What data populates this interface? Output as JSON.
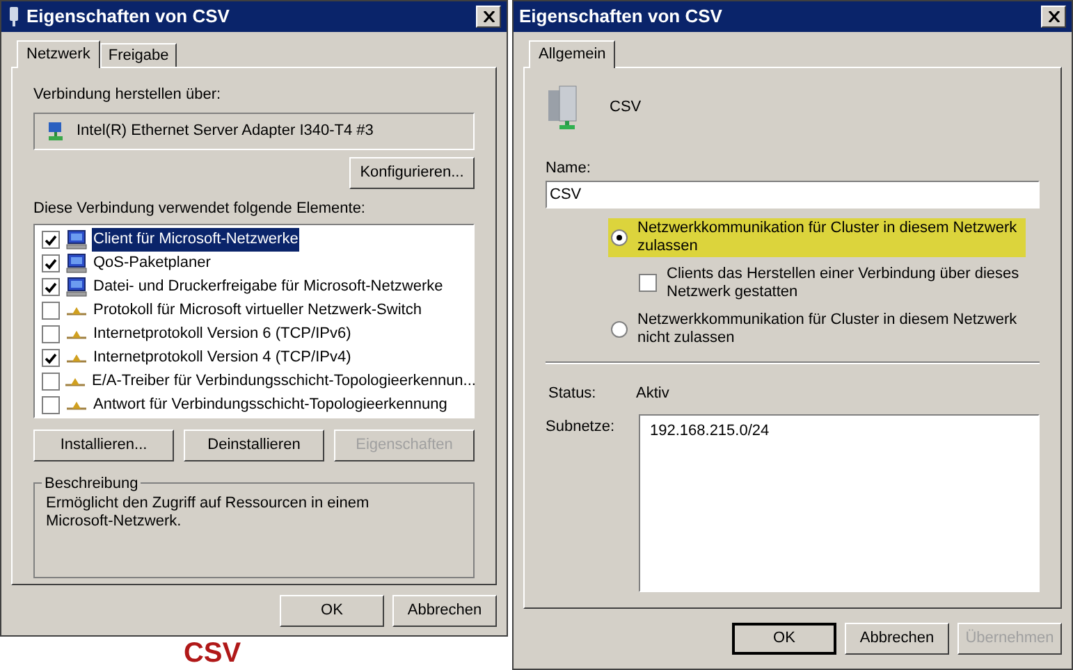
{
  "left_window": {
    "title": "Eigenschaften von CSV",
    "tabs": [
      {
        "label": "Netzwerk",
        "selected": true
      },
      {
        "label": "Freigabe",
        "selected": false
      }
    ],
    "connect_label": "Verbindung herstellen über:",
    "adapter": "Intel(R) Ethernet Server Adapter I340-T4 #3",
    "configure_button": "Konfigurieren...",
    "elements_label": "Diese Verbindung verwendet folgende Elemente:",
    "elements": [
      {
        "kind": "service",
        "label": "Client für Microsoft-Netzwerke",
        "checked": true,
        "selected": true
      },
      {
        "kind": "service",
        "label": "QoS-Paketplaner",
        "checked": true,
        "selected": false
      },
      {
        "kind": "service",
        "label": "Datei- und Druckerfreigabe für Microsoft-Netzwerke",
        "checked": true,
        "selected": false
      },
      {
        "kind": "protocol",
        "label": "Protokoll für Microsoft virtueller Netzwerk-Switch",
        "checked": false,
        "selected": false
      },
      {
        "kind": "protocol",
        "label": "Internetprotokoll Version 6 (TCP/IPv6)",
        "checked": false,
        "selected": false
      },
      {
        "kind": "protocol",
        "label": "Internetprotokoll Version 4 (TCP/IPv4)",
        "checked": true,
        "selected": false
      },
      {
        "kind": "protocol",
        "label": "E/A-Treiber für Verbindungsschicht-Topologieerkennun...",
        "checked": false,
        "selected": false
      },
      {
        "kind": "protocol",
        "label": "Antwort für Verbindungsschicht-Topologieerkennung",
        "checked": false,
        "selected": false
      }
    ],
    "element_buttons": [
      {
        "label": "Installieren...",
        "disabled": false,
        "default": false
      },
      {
        "label": "Deinstallieren",
        "disabled": false,
        "default": false
      },
      {
        "label": "Eigenschaften",
        "disabled": true,
        "default": false
      }
    ],
    "description": {
      "title": "Beschreibung",
      "text": "Ermöglicht den Zugriff auf Ressourcen in einem Microsoft-Netzwerk."
    },
    "buttons": [
      {
        "label": "OK",
        "disabled": false,
        "default": false
      },
      {
        "label": "Abbrechen",
        "disabled": false,
        "default": false
      }
    ]
  },
  "caption": "CSV",
  "right_window": {
    "title": "Eigenschaften von CSV",
    "tabs": [
      {
        "label": "Allgemein",
        "selected": true
      }
    ],
    "network_name": "CSV",
    "name_label": "Name:",
    "name_value": "CSV",
    "options": [
      {
        "kind": "radio",
        "label": "Netzwerkkommunikation für Cluster in diesem Netzwerk zulassen",
        "selected": true,
        "highlighted": true
      },
      {
        "kind": "checkbox",
        "label": "Clients das Herstellen einer Verbindung über dieses Netzwerk gestatten",
        "checked": false,
        "highlighted": false
      },
      {
        "kind": "radio",
        "label": "Netzwerkkommunikation für Cluster in diesem Netzwerk nicht zulassen",
        "selected": false,
        "highlighted": false
      }
    ],
    "status_label": "Status:",
    "status_value": "Aktiv",
    "subnets_label": "Subnetze:",
    "subnets": [
      "192.168.215.0/24"
    ],
    "buttons": [
      {
        "label": "OK",
        "disabled": false,
        "default": true
      },
      {
        "label": "Abbrechen",
        "disabled": false,
        "default": false
      },
      {
        "label": "Übernehmen",
        "disabled": true,
        "default": false
      }
    ]
  }
}
